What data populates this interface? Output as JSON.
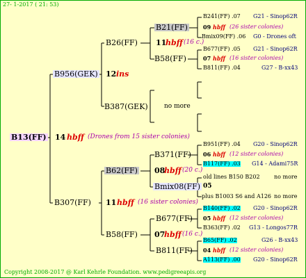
{
  "header": {
    "date": "27-  1-2017 ( 21: 53)"
  },
  "footer": {
    "copyright": "Copyright 2008-2017 @ Karl Kehrle Foundation.   www.pedigreeapis.org"
  },
  "root": {
    "id": "B13(FF)",
    "num": "14",
    "tag": "hbff",
    "note": "(Drones from 15 sister colonies)"
  },
  "g1": {
    "top": {
      "id": "B956(GEK)",
      "num": "12",
      "tag": "ins"
    },
    "bottom": {
      "id": "B307(FF)",
      "num": "11",
      "tag": "hbff",
      "note": "(16 sister colonies)"
    }
  },
  "g2": {
    "b26": {
      "id": "B26(FF)",
      "num": "11",
      "tag": "hbff",
      "note": "(16 c.)"
    },
    "b387": {
      "id": "B387(GEK)",
      "note": "no more"
    },
    "b62": {
      "id": "B62(FF)",
      "num": "08",
      "tag": "hbff",
      "note": "(20 c.)"
    },
    "b58": {
      "id": "B58(FF)",
      "num": "07",
      "tag": "hbff",
      "note": "(16 c.)"
    }
  },
  "g3": {
    "b21": {
      "id": "B21(FF)",
      "num": "09",
      "tag": "hbff",
      "note": "(26 sister colonies)"
    },
    "b58a": {
      "id": "B58(FF)",
      "num": "07",
      "tag": "hbff",
      "note": "(16 sister colonies)"
    },
    "b371": {
      "id": "B371(FF)",
      "num": "06",
      "tag": "hbff",
      "note": "(12 sister colonies)"
    },
    "bmix08": {
      "id": "Bmix08(FF)",
      "num": "05"
    },
    "b677": {
      "id": "B677(FF)",
      "num": "05",
      "tag": "hbff",
      "note": "(12 sister colonies)"
    },
    "b811": {
      "id": "B811(FF)",
      "num": "04",
      "tag": "hbff",
      "note": "(12 sister colonies)"
    }
  },
  "g4": [
    {
      "id": "B241(FF)",
      "val": ".07",
      "ref": "G21 - Sinop62R"
    },
    {
      "id": "Bmix09(FF)",
      "val": ".06",
      "ref": "G0 - Drones oft"
    },
    {
      "id": "B677(FF)",
      "val": ".05",
      "ref": "G21 - Sinop62R"
    },
    {
      "id": "B811(FF)",
      "val": ".04",
      "ref": "G27 - B-xx43"
    },
    {
      "id": "B951(FF)",
      "val": ".04",
      "ref": "G20 - Sinop62R"
    },
    {
      "id": "B117(FF)",
      "val": ".03",
      "ref": "G14 - Adami75R"
    },
    {
      "id": "old lines B150 B202",
      "val": "",
      "ref": "no more"
    },
    {
      "id": "plus B1003 S6 and A126",
      "val": "",
      "ref": "no more"
    },
    {
      "id": "B140(FF)",
      "val": ".02",
      "ref": "G20 - Sinop62R"
    },
    {
      "id": "B363(FF)",
      "val": ".02",
      "ref": "G13 - Longos77R"
    },
    {
      "id": "B65(FF)",
      "val": ".02",
      "ref": "G26 - B-xx43"
    },
    {
      "id": "A113(FF)",
      "val": ".00",
      "ref": "G20 - Sinop62R"
    }
  ],
  "colors": {
    "background": "#ffffc8",
    "border": "#00aa00",
    "red": "#dd0000",
    "purple": "#aa00aa",
    "blue": "#000077",
    "cyan": "#00ffff"
  }
}
